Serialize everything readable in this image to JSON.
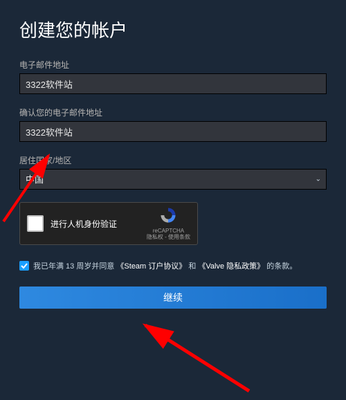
{
  "title": "创建您的帐户",
  "email": {
    "label": "电子邮件地址",
    "value": "3322软件站"
  },
  "confirm_email": {
    "label": "确认您的电子邮件地址",
    "value": "3322软件站"
  },
  "country": {
    "label": "居住国家/地区",
    "value": "中国"
  },
  "captcha": {
    "label": "进行人机身份验证",
    "brand": "reCAPTCHA",
    "legal": "隐私权 - 使用条款"
  },
  "agree": {
    "prefix": "我已年满 13 周岁并同意",
    "link1": "《Steam 订户协议》",
    "mid": "和",
    "link2": "《Valve 隐私政策》",
    "suffix": "的条款。"
  },
  "continue_label": "继续"
}
